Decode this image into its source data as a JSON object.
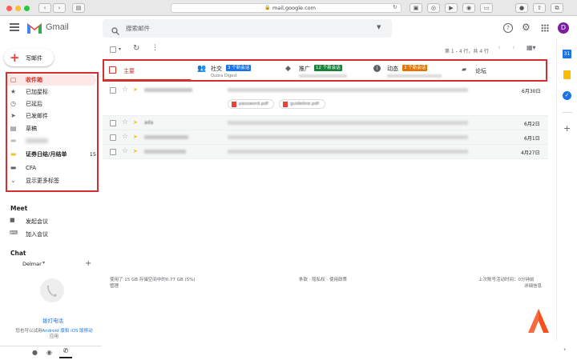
{
  "browser": {
    "url": "mail.google.com"
  },
  "app": {
    "name": "Gmail"
  },
  "search": {
    "placeholder": "搜索邮件"
  },
  "compose": {
    "label": "写邮件"
  },
  "sidebar": {
    "items": [
      {
        "label": "收件箱",
        "icon": "inbox-icon"
      },
      {
        "label": "已加星标",
        "icon": "star-icon"
      },
      {
        "label": "已延后",
        "icon": "clock-icon"
      },
      {
        "label": "已发邮件",
        "icon": "send-icon"
      },
      {
        "label": "草稿",
        "icon": "draft-icon"
      },
      {
        "label": "",
        "icon": "label-icon"
      },
      {
        "label": "证券日结/月结单",
        "icon": "label-icon",
        "count": "15"
      },
      {
        "label": "CFA",
        "icon": "label-icon"
      },
      {
        "label": "显示更多标签",
        "icon": "chevron-down-icon"
      }
    ]
  },
  "meet": {
    "title": "Meet",
    "start": "发起会议",
    "join": "加入会议"
  },
  "chat": {
    "title": "Chat",
    "user": "Delmar",
    "call": "拨打电话",
    "note_1": "您也可以试用",
    "note_link": "Android 版和 iOS 版移动",
    "note_2": "应用"
  },
  "toolbar": {
    "pagination": "第 1 - 4 行，共 4 行"
  },
  "tabs": [
    {
      "label": "主要",
      "icon": "inbox-icon"
    },
    {
      "label": "社交",
      "badge": "3 个新会话",
      "sub": "Quora Digest",
      "icon": "people-icon"
    },
    {
      "label": "推广",
      "badge": "12 个新会话",
      "sub": "",
      "icon": "tag-icon"
    },
    {
      "label": "动态",
      "badge": "3 个新会话",
      "sub": "",
      "icon": "info-icon"
    },
    {
      "label": "论坛",
      "icon": "forum-icon"
    }
  ],
  "emails": [
    {
      "sender": "",
      "subject": "",
      "date": "6月30日",
      "attachments": [
        "password.pdf",
        "guideline.pdf"
      ]
    },
    {
      "sender": "ada",
      "subject": "",
      "date": "6月2日"
    },
    {
      "sender": "",
      "subject": "",
      "date": "6月1日"
    },
    {
      "sender": "",
      "subject": "",
      "date": "4月27日"
    }
  ],
  "footer": {
    "storage": "使用了 15 GB 存储空间中的0.77 GB (5%)",
    "manage": "管理",
    "terms": "条款 · 隐私权 · 使用政策",
    "activity": "上次账号活动时间：0分钟前",
    "details": "详细信息"
  },
  "colors": {
    "accent_red": "#d93025",
    "highlight_box": "#d32f2f",
    "social_badge": "#1a73e8",
    "promo_badge": "#188038",
    "updates_badge": "#e37400"
  }
}
